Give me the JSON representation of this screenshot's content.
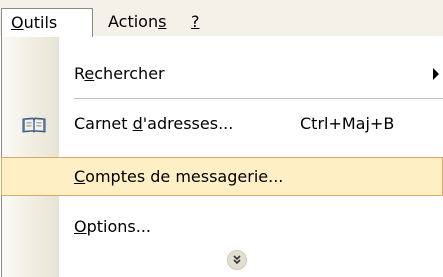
{
  "menubar": {
    "items": [
      {
        "label": "Outils",
        "mnemonic": "O",
        "rest": "utils",
        "active": true
      },
      {
        "label_pre": "Action",
        "mnemonic": "s",
        "label_post": ""
      },
      {
        "label": "?",
        "mnemonic": "?"
      }
    ]
  },
  "dropdown": {
    "items": [
      {
        "label_pre": "R",
        "mnemonic": "e",
        "label_post": "chercher",
        "has_submenu": true
      },
      {
        "label_pre": "Carnet ",
        "mnemonic": "d",
        "label_post": "'adresses...",
        "shortcut": "Ctrl+Maj+B",
        "icon": "address-book-icon"
      },
      {
        "label_pre": "",
        "mnemonic": "C",
        "label_post": "omptes de messagerie...",
        "highlighted": true
      },
      {
        "label_pre": "",
        "mnemonic": "O",
        "label_post": "ptions..."
      }
    ],
    "expand_icon": "chevron-double-down-icon"
  },
  "colors": {
    "menubar_bg": "#f3f1e8",
    "highlight_bg": "#ffefc4",
    "highlight_border": "#d8a96a",
    "icon_strip": "#e8e4d4"
  }
}
